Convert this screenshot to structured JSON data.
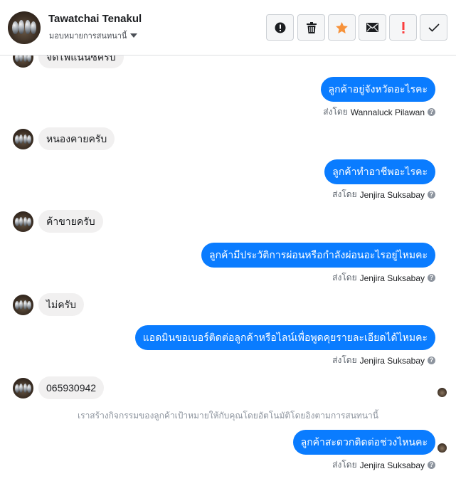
{
  "header": {
    "contact_name": "Tawatchai Tenakul",
    "assign_label": "มอบหมายการสนทนานี้",
    "actions": [
      {
        "name": "alert-icon",
        "glyph": "!"
      },
      {
        "name": "trash-icon",
        "glyph": "🗑"
      },
      {
        "name": "star-icon",
        "glyph": "★"
      },
      {
        "name": "envelope-icon",
        "glyph": "✉"
      },
      {
        "name": "spam-icon",
        "glyph": "!"
      },
      {
        "name": "check-icon",
        "glyph": "✓"
      }
    ]
  },
  "colors": {
    "outgoing_bubble": "#0a7cff",
    "incoming_bubble": "#f1f0f0",
    "star": "#f7923a",
    "spam": "#fa3e3e"
  },
  "messages": {
    "m0_partial": "จัดไฟแนนซ์ครับ",
    "m1_out": "ลูกค้าอยู่จังหวัดอะไรคะ",
    "m1_sent_prefix": "ส่งโดย",
    "m1_sender": "Wannaluck Pilawan",
    "m2_in": "หนองคายครับ",
    "m3_out": "ลูกค้าทำอาชีพอะไรคะ",
    "m3_sent_prefix": "ส่งโดย",
    "m3_sender": "Jenjira Suksabay",
    "m4_in": "ค้าขายครับ",
    "m5_out": "ลูกค้ามีประวัติการผ่อนหรือกำลังผ่อนอะไรอยู่ไหมคะ",
    "m5_sent_prefix": "ส่งโดย",
    "m5_sender": "Jenjira Suksabay",
    "m6_in": "ไม่ครับ",
    "m7_out": "แอดมินขอเบอร์ติดต่อลูกค้าหรือไลน์เพื่อพูดคุยรายละเอียดได้ไหมคะ",
    "m7_sent_prefix": "ส่งโดย",
    "m7_sender": "Jenjira Suksabay",
    "m8_in": "065930942",
    "system_note": "เราสร้างกิจกรรมของลูกค้าเป้าหมายให้กับคุณโดยอัตโนมัติโดยอิงตามการสนทนานี้",
    "m9_out": "ลูกค้าสะดวกติดต่อช่วงไหนคะ",
    "m9_sent_prefix": "ส่งโดย",
    "m9_sender": "Jenjira Suksabay",
    "info_glyph": "?"
  }
}
